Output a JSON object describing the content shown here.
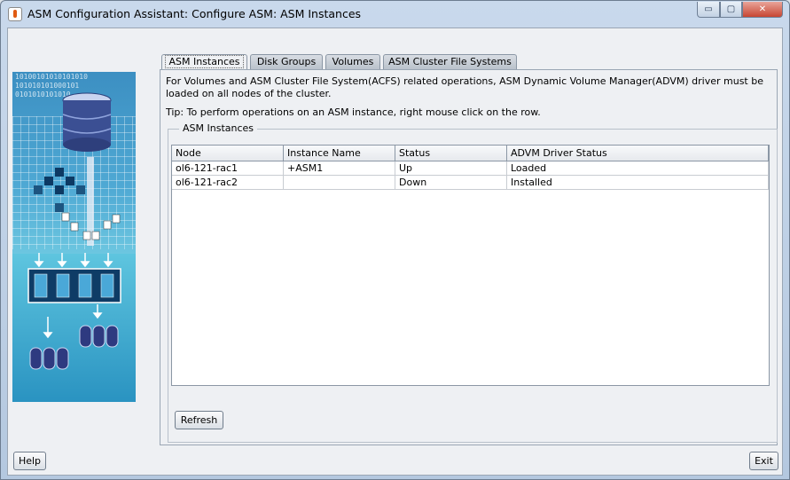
{
  "window": {
    "title": "ASM Configuration Assistant: Configure ASM: ASM Instances",
    "minimize_glyph": "▭",
    "maximize_glyph": "▢",
    "close_glyph": "✕"
  },
  "side_art": {
    "binary_lines": [
      "10100101010101010",
      "101010101000101",
      "0101010101010"
    ]
  },
  "tabs": [
    {
      "label": "ASM Instances",
      "active": true
    },
    {
      "label": "Disk Groups",
      "active": false
    },
    {
      "label": "Volumes",
      "active": false
    },
    {
      "label": "ASM Cluster File Systems",
      "active": false
    }
  ],
  "panel": {
    "description": "For Volumes and ASM Cluster File System(ACFS) related operations, ASM Dynamic Volume Manager(ADVM) driver must be loaded on all nodes of the cluster.",
    "tip": "Tip: To perform operations on an ASM instance, right mouse click on the row.",
    "group_title": "ASM Instances"
  },
  "table": {
    "columns": [
      "Node",
      "Instance Name",
      "Status",
      "ADVM Driver Status"
    ],
    "rows": [
      [
        "ol6-121-rac1",
        "+ASM1",
        "Up",
        "Loaded"
      ],
      [
        "ol6-121-rac2",
        "",
        "Down",
        "Installed"
      ]
    ]
  },
  "buttons": {
    "refresh": "Refresh",
    "help": "Help",
    "exit": "Exit"
  }
}
